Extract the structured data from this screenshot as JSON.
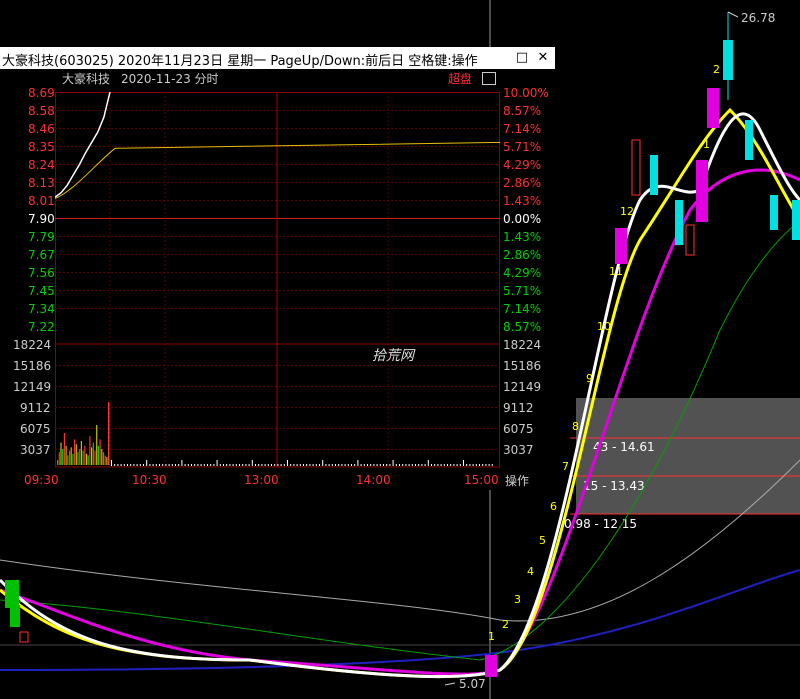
{
  "main_chart": {
    "high_label": "26.78",
    "low_label": "5.07",
    "wave_labels": [
      "1",
      "2",
      "3",
      "4",
      "5",
      "6",
      "7",
      "8",
      "9",
      "10",
      "11",
      "12",
      "1",
      "2"
    ],
    "price_levels": [
      {
        "text": "43 - 14.61"
      },
      {
        "text": "15 - 13.43"
      },
      {
        "text": "0.98 - 12.15"
      }
    ]
  },
  "popup": {
    "title": "大豪科技(603025) 2020年11月23日 星期一 PageUp/Down:前后日 空格键:操作",
    "restore_btn": "□",
    "close_btn": "✕",
    "stock_name": "大豪科技",
    "date_label": "2020-11-23 分时",
    "mode_label": "超盘",
    "price_labels": [
      "8.69",
      "8.58",
      "8.46",
      "8.35",
      "8.24",
      "8.13",
      "8.01",
      "7.90",
      "7.79",
      "7.67",
      "7.56",
      "7.45",
      "7.34",
      "7.22"
    ],
    "pct_labels": [
      "10.00%",
      "8.57%",
      "7.14%",
      "5.71%",
      "4.29%",
      "2.86%",
      "1.43%",
      "0.00%",
      "1.43%",
      "2.86%",
      "4.29%",
      "5.71%",
      "7.14%",
      "8.57%"
    ],
    "vol_labels": [
      "18224",
      "15186",
      "12149",
      "9112",
      "6075",
      "3037"
    ],
    "time_labels": [
      "09:30",
      "10:30",
      "13:00",
      "14:00",
      "15:00"
    ],
    "operate_label": "操作",
    "watermark": "拾荒网",
    "colors": {
      "up": "#ff3030",
      "down": "#00d000",
      "flat": "#ffffff",
      "avg": "#e8c000"
    }
  },
  "chart_data": {
    "type": "line",
    "title": "大豪科技 2020-11-23 分时",
    "x": [
      "09:30",
      "09:35",
      "09:40",
      "09:45",
      "09:50",
      "09:55",
      "10:00",
      "10:05",
      "10:10",
      "10:12"
    ],
    "series": [
      {
        "values": [
          7.98,
          8.01,
          8.06,
          8.13,
          8.2,
          8.28,
          8.35,
          8.42,
          8.52,
          8.69
        ]
      }
    ],
    "ylim": [
      7.11,
      8.69
    ],
    "ylabel": "",
    "xlabel": ""
  }
}
